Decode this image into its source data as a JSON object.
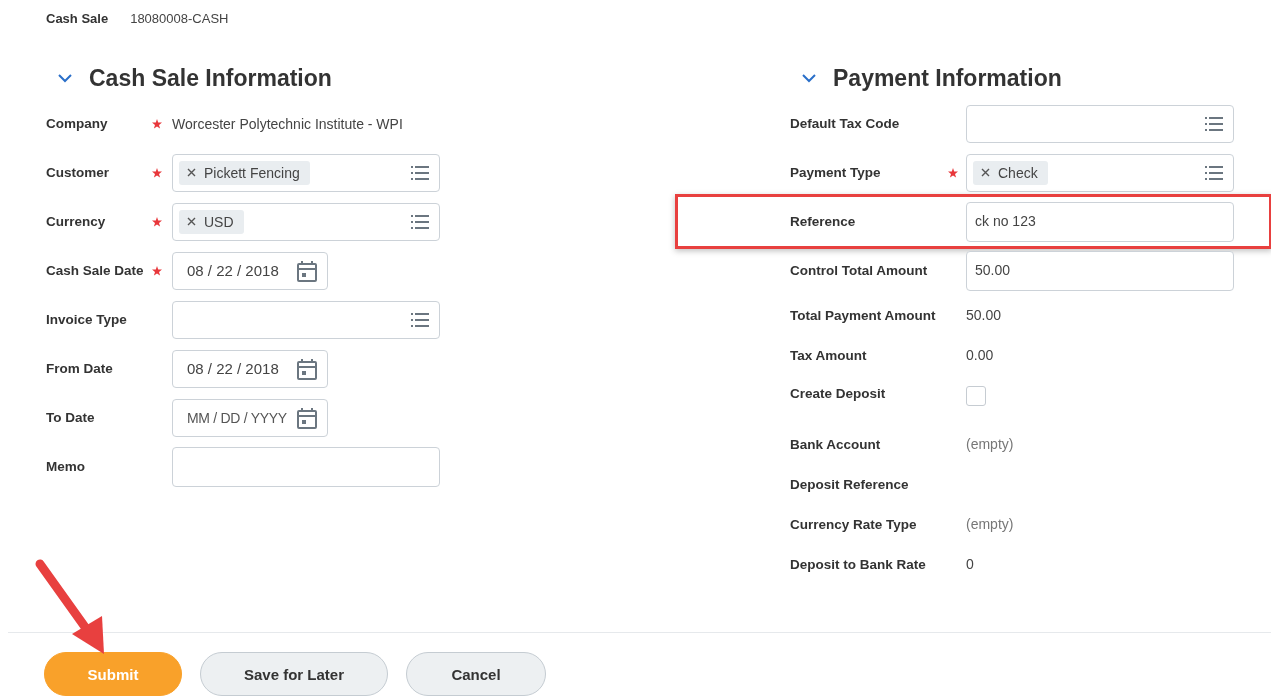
{
  "header": {
    "label": "Cash Sale",
    "value": "18080008-CASH"
  },
  "sections": [
    {
      "title": "Cash Sale Information",
      "expanded": true,
      "fields": [
        {
          "label": "Company",
          "required": true,
          "kind": "text",
          "value": "Worcester Polytechnic Institute - WPI"
        },
        {
          "label": "Customer",
          "required": true,
          "kind": "lookup",
          "tokens": [
            "Pickett Fencing"
          ]
        },
        {
          "label": "Currency",
          "required": true,
          "kind": "lookup",
          "tokens": [
            "USD"
          ]
        },
        {
          "label": "Cash Sale Date",
          "required": true,
          "kind": "date",
          "value": "08 / 22 / 2018"
        },
        {
          "label": "Invoice Type",
          "required": false,
          "kind": "lookup"
        },
        {
          "label": "From Date",
          "required": false,
          "kind": "date",
          "value": "08 / 22 / 2018"
        },
        {
          "label": "To Date",
          "required": false,
          "kind": "date",
          "placeholder": "MM / DD / YYYY"
        },
        {
          "label": "Memo",
          "required": false,
          "kind": "input"
        }
      ]
    },
    {
      "title": "Payment Information",
      "expanded": true,
      "fields": [
        {
          "label": "Default Tax Code",
          "required": false,
          "kind": "lookup"
        },
        {
          "label": "Payment Type",
          "required": true,
          "kind": "lookup",
          "tokens": [
            "Check"
          ]
        },
        {
          "label": "Reference",
          "required": false,
          "kind": "input",
          "value": "ck no 123",
          "highlighted": true
        },
        {
          "label": "Control Total Amount",
          "required": false,
          "kind": "input",
          "value": "50.00"
        },
        {
          "label": "Total Payment Amount",
          "required": false,
          "kind": "text",
          "value": "50.00"
        },
        {
          "label": "Tax Amount",
          "required": false,
          "kind": "text",
          "value": "0.00"
        },
        {
          "label": "Create Deposit",
          "required": false,
          "kind": "checkbox",
          "checked": false
        },
        {
          "label": "Bank Account",
          "required": false,
          "kind": "text",
          "value": "(empty)",
          "muted": true
        },
        {
          "label": "Deposit Reference",
          "required": false,
          "kind": "text"
        },
        {
          "label": "Currency Rate Type",
          "required": false,
          "kind": "text",
          "value": "(empty)",
          "muted": true
        },
        {
          "label": "Deposit to Bank Rate",
          "required": false,
          "kind": "text",
          "value": "0"
        }
      ]
    }
  ],
  "buttons": [
    {
      "label": "Submit",
      "kind": "primary",
      "pointed_at": true
    },
    {
      "label": "Save for Later",
      "kind": "secondary",
      "pointed_at": false
    },
    {
      "label": "Cancel",
      "kind": "secondary",
      "pointed_at": false
    }
  ]
}
